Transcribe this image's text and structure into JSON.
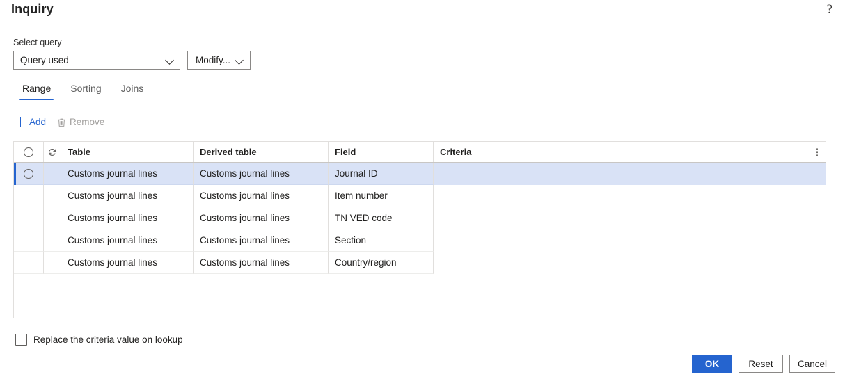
{
  "dialog": {
    "title": "Inquiry",
    "help_icon": "question-mark-icon"
  },
  "query": {
    "label": "Select query",
    "selected": "Query used",
    "dropdown_icon": "chevron-down-icon",
    "modify_label": "Modify...",
    "modify_icon": "chevron-down-icon"
  },
  "tabs": [
    {
      "label": "Range",
      "active": true
    },
    {
      "label": "Sorting",
      "active": false
    },
    {
      "label": "Joins",
      "active": false
    }
  ],
  "commands": {
    "add_label": "Add",
    "add_icon": "plus-icon",
    "remove_label": "Remove",
    "remove_icon": "trash-icon",
    "remove_disabled": true
  },
  "grid": {
    "header": {
      "select_icon": "radio-circle-icon",
      "refresh_icon": "refresh-icon",
      "table": "Table",
      "derived_table": "Derived table",
      "field": "Field",
      "criteria": "Criteria",
      "more_icon": "more-vertical-icon"
    },
    "rows": [
      {
        "selected": true,
        "table": "Customs journal lines",
        "derived_table": "Customs journal lines",
        "field": "Journal ID",
        "criteria": ""
      },
      {
        "selected": false,
        "table": "Customs journal lines",
        "derived_table": "Customs journal lines",
        "field": "Item number",
        "criteria": ""
      },
      {
        "selected": false,
        "table": "Customs journal lines",
        "derived_table": "Customs journal lines",
        "field": "TN VED code",
        "criteria": ""
      },
      {
        "selected": false,
        "table": "Customs journal lines",
        "derived_table": "Customs journal lines",
        "field": "Section",
        "criteria": ""
      },
      {
        "selected": false,
        "table": "Customs journal lines",
        "derived_table": "Customs journal lines",
        "field": "Country/region",
        "criteria": ""
      }
    ]
  },
  "options": {
    "replace_criteria_label": "Replace the criteria value on lookup",
    "replace_criteria_checked": false
  },
  "footer": {
    "ok_label": "OK",
    "reset_label": "Reset",
    "cancel_label": "Cancel"
  },
  "colors": {
    "accent": "#2564cf",
    "row_selected_bg": "#d9e2f6",
    "border": "#e1dfdd",
    "disabled_text": "#a19f9d"
  }
}
